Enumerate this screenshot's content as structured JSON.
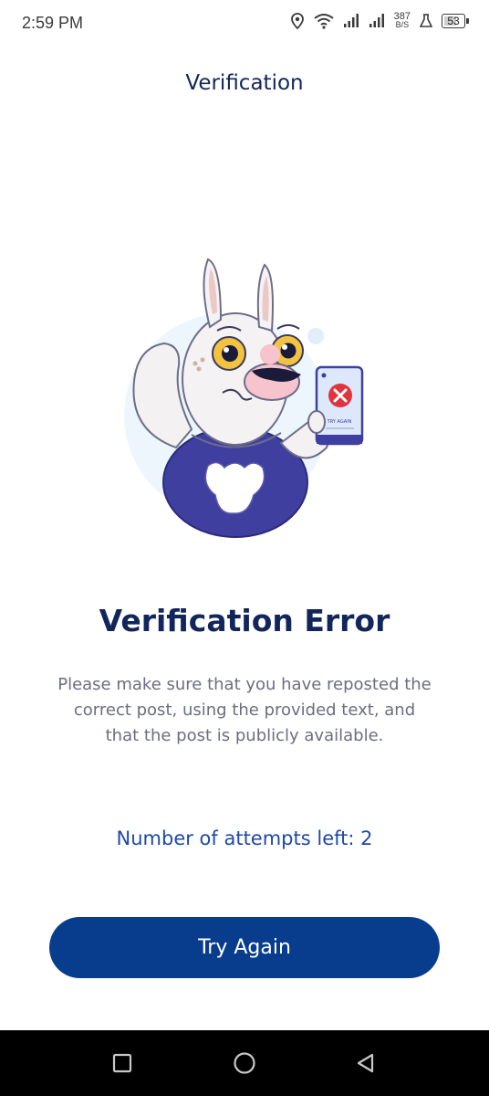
{
  "status_bar": {
    "time": "2:59 PM",
    "net_speed_value": "387",
    "net_speed_unit": "B/S",
    "battery_level": "53",
    "icons": [
      "location-icon",
      "wifi-icon",
      "signal-icon",
      "signal-icon",
      "flask-icon",
      "battery-icon"
    ]
  },
  "header": {
    "title": "Verification"
  },
  "illustration": {
    "phone_label": "TRY AGAIN",
    "icons": [
      "bunny-illustration",
      "error-x-icon"
    ]
  },
  "main": {
    "title": "Verification Error",
    "message": "Please make sure that you have reposted the correct post, using the provided text, and that the post is publicly available.",
    "attempts_text": "Number of attempts left: 2",
    "button_label": "Try Again"
  },
  "nav_bar": {
    "icons": [
      "recents-square-icon",
      "home-circle-icon",
      "back-triangle-icon"
    ]
  },
  "colors": {
    "title": "#13265c",
    "message": "#6b6e80",
    "attempts": "#1f49a6",
    "button": "#083d8e",
    "error_red": "#e0343f",
    "body_blue": "#3f3f9f"
  }
}
